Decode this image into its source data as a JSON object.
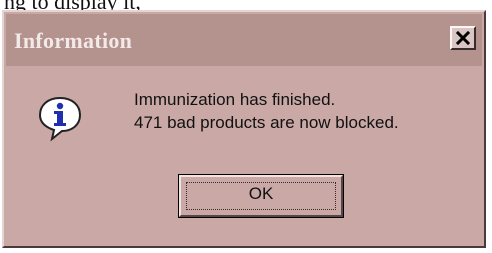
{
  "background_text": "ng to display it,",
  "dialog": {
    "title": "Information",
    "message_line1": "Immunization has finished.",
    "message_line2": "471 bad products are now blocked.",
    "ok_label": "OK",
    "icon": "info-icon",
    "close_icon": "close-icon"
  },
  "colors": {
    "dialog_background": "#c9a8a6",
    "titlebar_background": "#b4928e",
    "title_text": "#f2e9e8",
    "info_blue": "#1f2fb0"
  }
}
